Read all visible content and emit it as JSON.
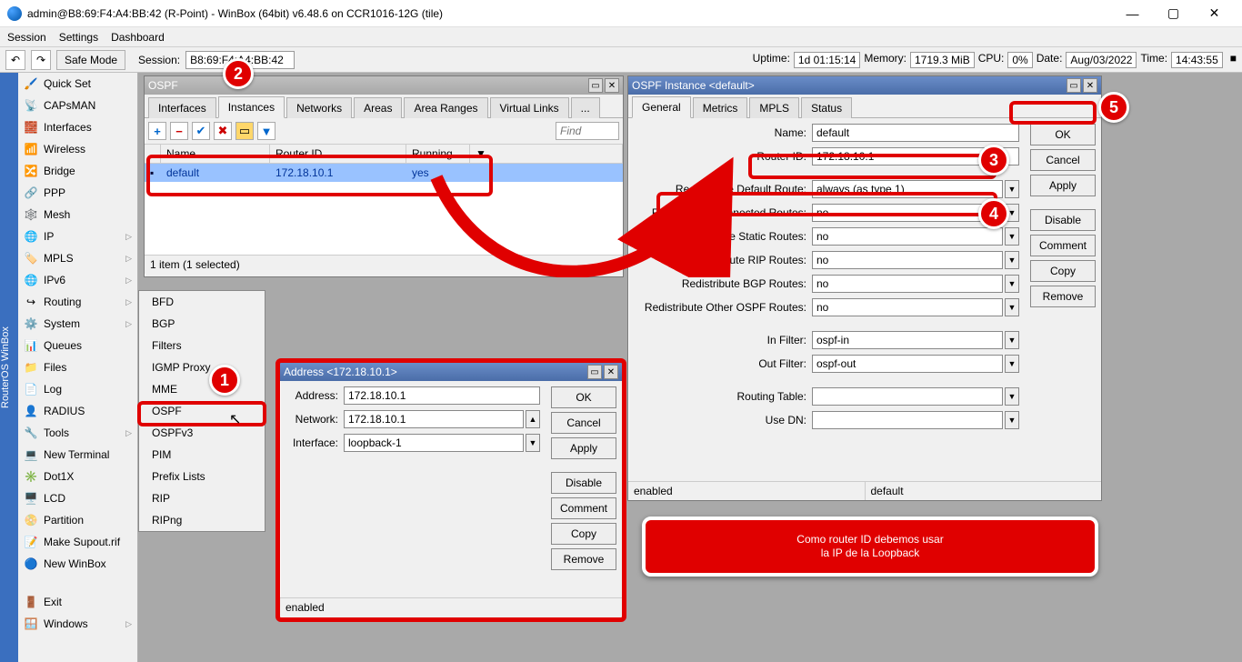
{
  "titlebar": {
    "text": "admin@B8:69:F4:A4:BB:42 (R-Point) - WinBox (64bit) v6.48.6 on CCR1016-12G (tile)"
  },
  "menu": {
    "session": "Session",
    "settings": "Settings",
    "dashboard": "Dashboard"
  },
  "toolrow": {
    "safe_mode": "Safe Mode",
    "session_label": "Session:",
    "session_value": "B8:69:F4:A4:BB:42",
    "uptime_label": "Uptime:",
    "uptime_value": "1d 01:15:14",
    "memory_label": "Memory:",
    "memory_value": "1719.3 MiB",
    "cpu_label": "CPU:",
    "cpu_value": "0%",
    "date_label": "Date:",
    "date_value": "Aug/03/2022",
    "time_label": "Time:",
    "time_value": "14:43:55"
  },
  "rosbar": "RouterOS WinBox",
  "sidebar": [
    {
      "icon": "🖌️",
      "label": "Quick Set"
    },
    {
      "icon": "📡",
      "label": "CAPsMAN"
    },
    {
      "icon": "🧱",
      "label": "Interfaces"
    },
    {
      "icon": "📶",
      "label": "Wireless"
    },
    {
      "icon": "🔀",
      "label": "Bridge"
    },
    {
      "icon": "🔗",
      "label": "PPP"
    },
    {
      "icon": "🕸️",
      "label": "Mesh"
    },
    {
      "icon": "🌐",
      "label": "IP",
      "sub": true
    },
    {
      "icon": "🏷️",
      "label": "MPLS",
      "sub": true
    },
    {
      "icon": "🌐",
      "label": "IPv6",
      "sub": true
    },
    {
      "icon": "↪",
      "label": "Routing",
      "sub": true
    },
    {
      "icon": "⚙️",
      "label": "System",
      "sub": true
    },
    {
      "icon": "📊",
      "label": "Queues"
    },
    {
      "icon": "📁",
      "label": "Files"
    },
    {
      "icon": "📄",
      "label": "Log"
    },
    {
      "icon": "👤",
      "label": "RADIUS"
    },
    {
      "icon": "🔧",
      "label": "Tools",
      "sub": true
    },
    {
      "icon": "💻",
      "label": "New Terminal"
    },
    {
      "icon": "✳️",
      "label": "Dot1X"
    },
    {
      "icon": "🖥️",
      "label": "LCD"
    },
    {
      "icon": "📀",
      "label": "Partition"
    },
    {
      "icon": "📝",
      "label": "Make Supout.rif"
    },
    {
      "icon": "🔵",
      "label": "New WinBox"
    },
    {
      "icon": "🚪",
      "label": "Exit"
    },
    {
      "icon": "🪟",
      "label": "Windows",
      "sub": true
    }
  ],
  "routing_submenu": [
    "BFD",
    "BGP",
    "Filters",
    "IGMP Proxy",
    "MME",
    "OSPF",
    "OSPFv3",
    "PIM",
    "Prefix Lists",
    "RIP",
    "RIPng"
  ],
  "ospf_win": {
    "title": "OSPF",
    "tabs": [
      "Interfaces",
      "Instances",
      "Networks",
      "Areas",
      "Area Ranges",
      "Virtual Links",
      "..."
    ],
    "active_tab": 1,
    "find_ph": "Find",
    "cols": {
      "name": "Name",
      "router_id": "Router ID",
      "running": "Running"
    },
    "row": {
      "name": "default",
      "router_id": "172.18.10.1",
      "running": "yes"
    },
    "status": "1 item (1 selected)"
  },
  "instance_win": {
    "title": "OSPF Instance <default>",
    "tabs": [
      "General",
      "Metrics",
      "MPLS",
      "Status"
    ],
    "active_tab": 0,
    "labels": {
      "name": "Name:",
      "router_id": "Router ID:",
      "redist_default": "Redistribute Default Route:",
      "redist_connected": "Redistribute Connected Routes:",
      "redist_static": "Redistribute Static Routes:",
      "redist_rip": "Redistribute RIP Routes:",
      "redist_bgp": "Redistribute BGP Routes:",
      "redist_other": "Redistribute Other OSPF Routes:",
      "in_filter": "In Filter:",
      "out_filter": "Out Filter:",
      "routing_table": "Routing Table:",
      "use_dn": "Use DN:"
    },
    "values": {
      "name": "default",
      "router_id": "172.18.10.1",
      "redist_default": "always (as type 1)",
      "redist_connected": "no",
      "redist_static": "no",
      "redist_rip": "no",
      "redist_bgp": "no",
      "redist_other": "no",
      "in_filter": "ospf-in",
      "out_filter": "ospf-out",
      "routing_table": "",
      "use_dn": ""
    },
    "buttons": {
      "ok": "OK",
      "cancel": "Cancel",
      "apply": "Apply",
      "disable": "Disable",
      "comment": "Comment",
      "copy": "Copy",
      "remove": "Remove"
    },
    "status_left": "enabled",
    "status_right": "default"
  },
  "addr_win": {
    "title": "Address <172.18.10.1>",
    "labels": {
      "address": "Address:",
      "network": "Network:",
      "interface": "Interface:"
    },
    "values": {
      "address": "172.18.10.1",
      "network": "172.18.10.1",
      "interface": "loopback-1"
    },
    "buttons": {
      "ok": "OK",
      "cancel": "Cancel",
      "apply": "Apply",
      "disable": "Disable",
      "comment": "Comment",
      "copy": "Copy",
      "remove": "Remove"
    },
    "status": "enabled"
  },
  "annotation": {
    "line1": "Como router ID debemos usar",
    "line2": "la IP de la Loopback"
  }
}
